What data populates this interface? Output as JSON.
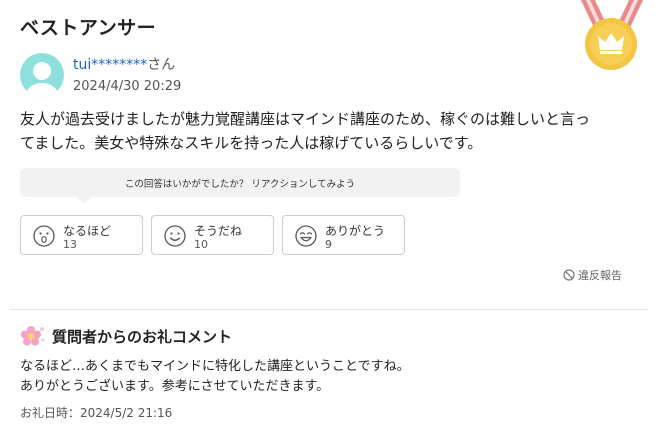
{
  "header": {
    "title": "ベストアンサー",
    "medal_icon": "crown-medal-icon"
  },
  "answer": {
    "username": "tui********",
    "honorific": "さん",
    "date": "2024/4/30 20:29",
    "line1": "友人が過去受けましたが魅力覚醒講座はマインド講座のため、稼ぐのは難しいと言っ",
    "line2": "てました。美女や特殊なスキルを持った人は稼げているらしいです。"
  },
  "reaction_prompt": "この回答はいかがでしたか？ リアクションしてみよう",
  "reactions": [
    {
      "label": "なるほど",
      "count": "13",
      "icon": "surprised-face-icon"
    },
    {
      "label": "そうだね",
      "count": "10",
      "icon": "smile-face-icon"
    },
    {
      "label": "ありがとう",
      "count": "9",
      "icon": "grin-face-icon"
    }
  ],
  "report_label": "違反報告",
  "thanks": {
    "title": "質問者からのお礼コメント",
    "line1": "なるほど…あくまでもマインドに特化した講座ということですね。",
    "line2": "ありがとうございます。参考にさせていただきます。",
    "date_label": "お礼日時：2024/5/2 21:16"
  },
  "colors": {
    "username": "#1a63c5",
    "medal_gold": "#f4c542",
    "ribbon": "#e88a8a",
    "avatar": "#8fe0dc",
    "flower": "#f5a3c0"
  }
}
